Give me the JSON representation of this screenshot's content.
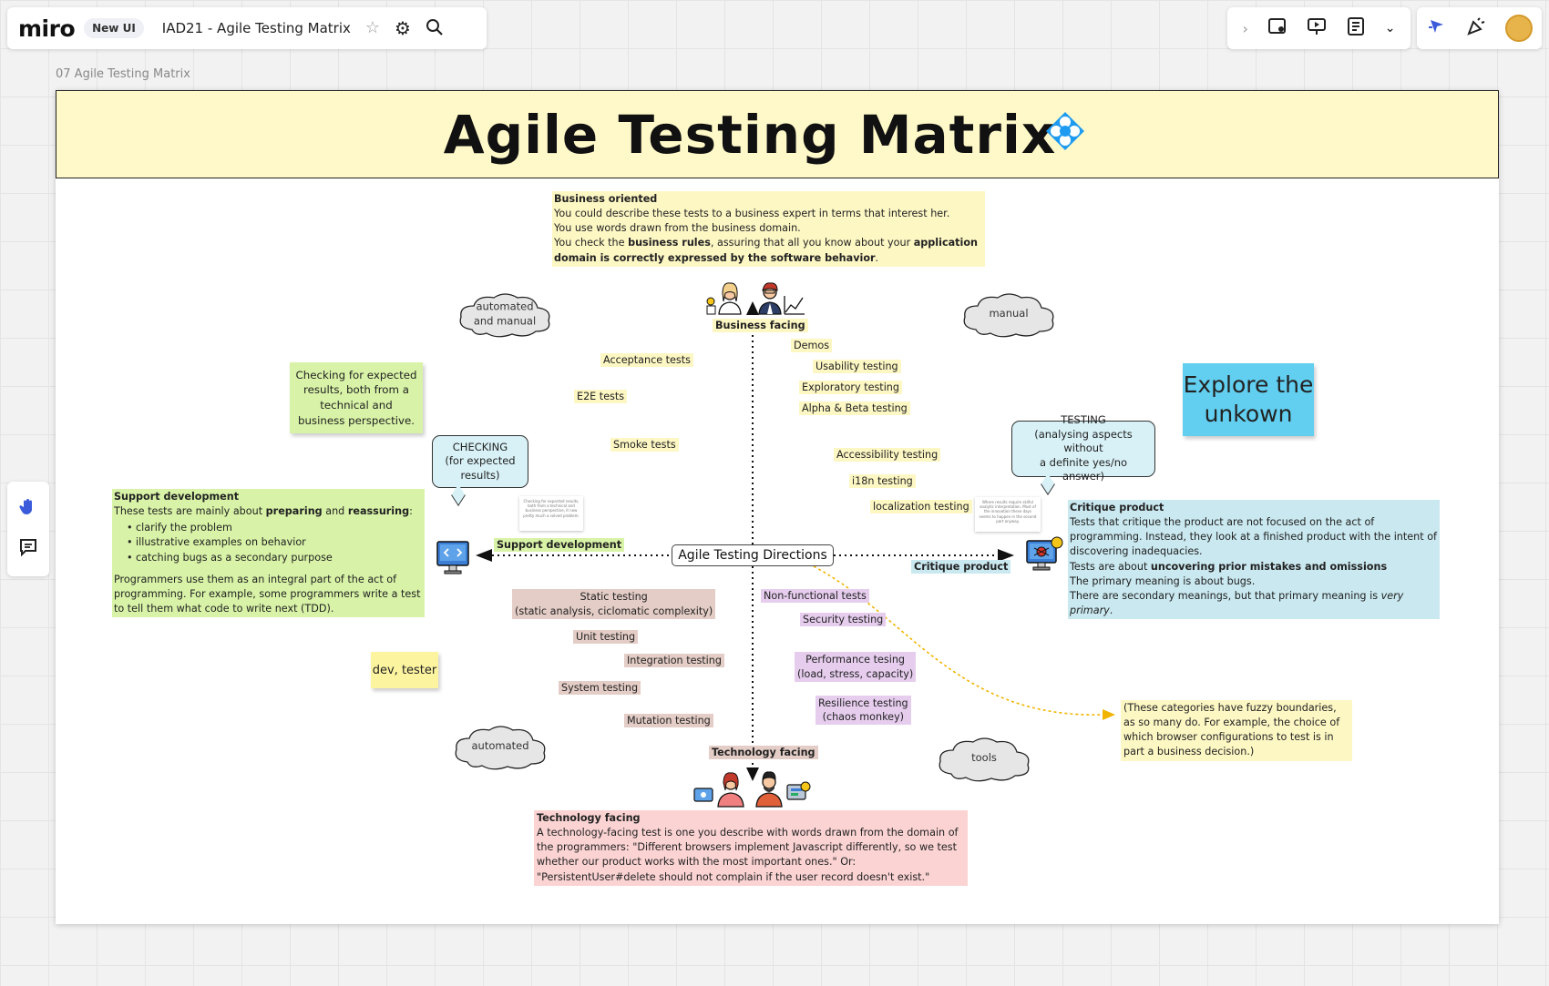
{
  "app": {
    "logo": "miro",
    "new_ui_badge": "New UI",
    "board_title": "IAD21 - Agile Testing Matrix",
    "frame_label": "07 Agile Testing Matrix"
  },
  "toolbar_icons": [
    "star-icon",
    "settings-icon",
    "search-icon",
    "chevron-right-icon",
    "frame-icon",
    "present-icon",
    "notes-icon",
    "chevron-down-icon",
    "cursor-icon",
    "celebrate-icon",
    "avatar"
  ],
  "left_tools_icons": [
    "hand-icon",
    "comment-icon"
  ],
  "colors": {
    "header_bg": "#fff9c9",
    "accent_blue": "#1e9bf0",
    "yellow_note": "#fdf7c4",
    "green_note": "#d8f3a7",
    "brown_tag": "#e4cdc6",
    "purple_tag": "#e6cdee",
    "blue_note": "#c9e8ef",
    "pink_note": "#fbd3d3",
    "sticky_blue": "#62cff0",
    "arrow_yellow": "#f0b400"
  },
  "board": {
    "title": "Agile Testing Matrix",
    "business_note": {
      "heading": "Business oriented",
      "line1": "You could describe these tests to a business expert in terms that interest her.",
      "line2": "You use words drawn from the business domain.",
      "line3_a": "You check the ",
      "line3_b": "business rules",
      "line3_c": ", assuring that all you know about your ",
      "line3_d": "application domain is correctly expressed by the software behavior",
      "line3_e": "."
    },
    "axis": {
      "top": "Business facing",
      "bottom": "Technology facing",
      "left": "Support development",
      "right": "Critique product",
      "center": "Agile Testing Directions"
    },
    "clouds": {
      "top_left": "automated\nand manual",
      "top_right": "manual",
      "bottom_left": "automated",
      "bottom_right": "tools"
    },
    "q2_tags": [
      "Acceptance tests",
      "E2E tests",
      "Smoke tests"
    ],
    "q3_tags": [
      "Demos",
      "Usability testing",
      "Exploratory testing",
      "Alpha & Beta testing",
      "Accessibility testing",
      "i18n testing",
      "localization testing"
    ],
    "q1_tags": {
      "static": "Static testing\n(static analysis, ciclomatic complexity)",
      "unit": "Unit testing",
      "integration": "Integration testing",
      "system": "System testing",
      "mutation": "Mutation testing"
    },
    "q4_tags": {
      "nonfunctional": "Non-functional tests",
      "security": "Security testing",
      "performance": "Performance tesing\n(load, stress, capacity)",
      "resilience": "Resilience testing\n(chaos monkey)"
    },
    "checking_note": "Checking for expected results, both from a technical and business perspective.",
    "checking_bubble": "CHECKING\n(for expected\nresults)",
    "testing_bubble": "TESTING\n(analysing aspects without\na definite yes/no answer)",
    "explore_sticky": "Explore the unkown",
    "dev_tester_sticky": "dev, tester",
    "support_note": {
      "heading": "Support development",
      "intro_a": "These tests are mainly about ",
      "intro_b": "preparing",
      "intro_c": " and ",
      "intro_d": "reassuring",
      "intro_e": ":",
      "bullets": [
        "clarify the problem",
        "illustrative examples on behavior",
        "catching bugs as a secondary purpose"
      ],
      "para": "Programmers use them as an integral part of the act of programming. For example, some programmers write a test to tell them what code to write next (TDD)."
    },
    "critique_note": {
      "heading": "Critique product",
      "line1": "Tests that critique the product are not focused on the act of programming. Instead, they look at a finished product with the intent of discovering inadequacies.",
      "line2_a": "Tests are about ",
      "line2_b": "uncovering prior mistakes and omissions",
      "line3": "The primary meaning is about bugs.",
      "line4_a": "There are secondary meanings, but that primary meaning is ",
      "line4_b": "very primary",
      "line4_c": "."
    },
    "fuzzy_note": "(These categories have fuzzy boundaries, as so many do. For example, the choice of which browser configurations to test is in part a business decision.)",
    "tech_note": {
      "heading": "Technology facing",
      "body": "A technology-facing test is one you describe with words drawn from the domain of the programmers: \"Different browsers implement Javascript differently, so we test whether our product works with the most important ones.\" Or: \"PersistentUser#delete should not complain if the user record doesn't exist.\""
    },
    "mini_left": "Checking for expected results, both from a technical and business perspective, it now pretty much a solved problem.",
    "mini_right": "Where results require skilful analytic interpretation. Most of the innovation these days seems to happen in the second part anyway."
  }
}
